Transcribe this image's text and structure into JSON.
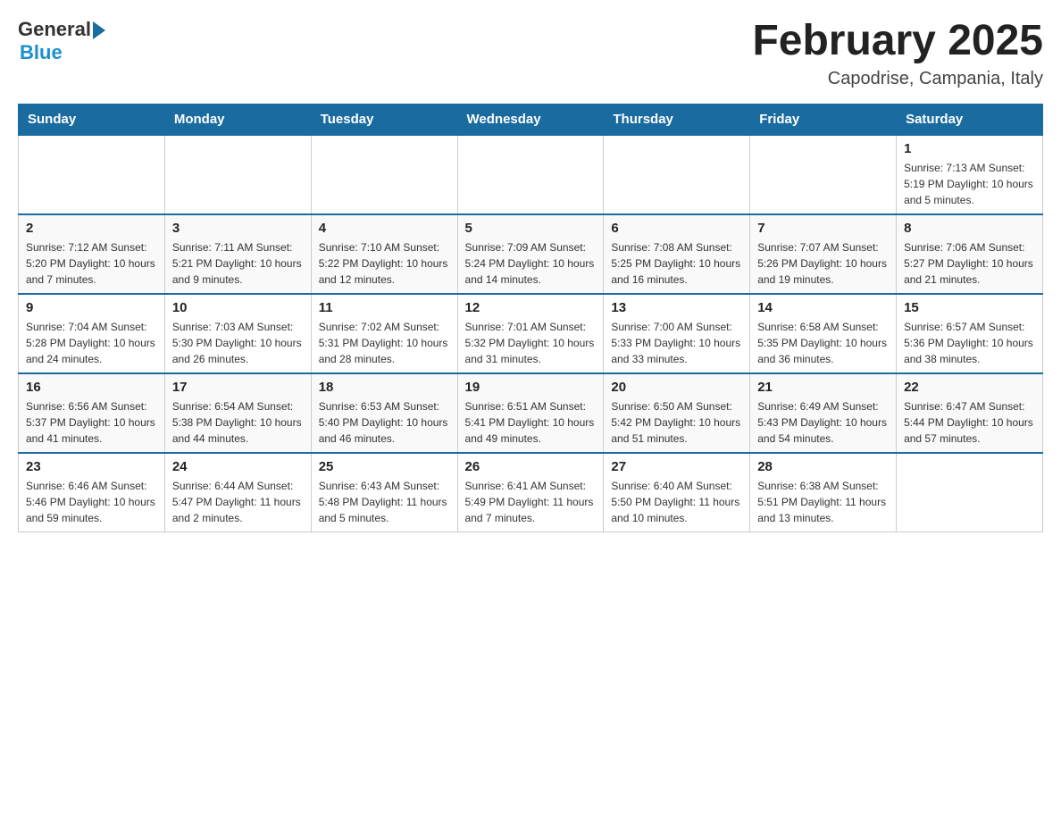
{
  "header": {
    "logo_general": "General",
    "logo_blue": "Blue",
    "title": "February 2025",
    "subtitle": "Capodrise, Campania, Italy"
  },
  "days_of_week": [
    "Sunday",
    "Monday",
    "Tuesday",
    "Wednesday",
    "Thursday",
    "Friday",
    "Saturday"
  ],
  "weeks": [
    [
      {
        "day": "",
        "info": ""
      },
      {
        "day": "",
        "info": ""
      },
      {
        "day": "",
        "info": ""
      },
      {
        "day": "",
        "info": ""
      },
      {
        "day": "",
        "info": ""
      },
      {
        "day": "",
        "info": ""
      },
      {
        "day": "1",
        "info": "Sunrise: 7:13 AM\nSunset: 5:19 PM\nDaylight: 10 hours and 5 minutes."
      }
    ],
    [
      {
        "day": "2",
        "info": "Sunrise: 7:12 AM\nSunset: 5:20 PM\nDaylight: 10 hours and 7 minutes."
      },
      {
        "day": "3",
        "info": "Sunrise: 7:11 AM\nSunset: 5:21 PM\nDaylight: 10 hours and 9 minutes."
      },
      {
        "day": "4",
        "info": "Sunrise: 7:10 AM\nSunset: 5:22 PM\nDaylight: 10 hours and 12 minutes."
      },
      {
        "day": "5",
        "info": "Sunrise: 7:09 AM\nSunset: 5:24 PM\nDaylight: 10 hours and 14 minutes."
      },
      {
        "day": "6",
        "info": "Sunrise: 7:08 AM\nSunset: 5:25 PM\nDaylight: 10 hours and 16 minutes."
      },
      {
        "day": "7",
        "info": "Sunrise: 7:07 AM\nSunset: 5:26 PM\nDaylight: 10 hours and 19 minutes."
      },
      {
        "day": "8",
        "info": "Sunrise: 7:06 AM\nSunset: 5:27 PM\nDaylight: 10 hours and 21 minutes."
      }
    ],
    [
      {
        "day": "9",
        "info": "Sunrise: 7:04 AM\nSunset: 5:28 PM\nDaylight: 10 hours and 24 minutes."
      },
      {
        "day": "10",
        "info": "Sunrise: 7:03 AM\nSunset: 5:30 PM\nDaylight: 10 hours and 26 minutes."
      },
      {
        "day": "11",
        "info": "Sunrise: 7:02 AM\nSunset: 5:31 PM\nDaylight: 10 hours and 28 minutes."
      },
      {
        "day": "12",
        "info": "Sunrise: 7:01 AM\nSunset: 5:32 PM\nDaylight: 10 hours and 31 minutes."
      },
      {
        "day": "13",
        "info": "Sunrise: 7:00 AM\nSunset: 5:33 PM\nDaylight: 10 hours and 33 minutes."
      },
      {
        "day": "14",
        "info": "Sunrise: 6:58 AM\nSunset: 5:35 PM\nDaylight: 10 hours and 36 minutes."
      },
      {
        "day": "15",
        "info": "Sunrise: 6:57 AM\nSunset: 5:36 PM\nDaylight: 10 hours and 38 minutes."
      }
    ],
    [
      {
        "day": "16",
        "info": "Sunrise: 6:56 AM\nSunset: 5:37 PM\nDaylight: 10 hours and 41 minutes."
      },
      {
        "day": "17",
        "info": "Sunrise: 6:54 AM\nSunset: 5:38 PM\nDaylight: 10 hours and 44 minutes."
      },
      {
        "day": "18",
        "info": "Sunrise: 6:53 AM\nSunset: 5:40 PM\nDaylight: 10 hours and 46 minutes."
      },
      {
        "day": "19",
        "info": "Sunrise: 6:51 AM\nSunset: 5:41 PM\nDaylight: 10 hours and 49 minutes."
      },
      {
        "day": "20",
        "info": "Sunrise: 6:50 AM\nSunset: 5:42 PM\nDaylight: 10 hours and 51 minutes."
      },
      {
        "day": "21",
        "info": "Sunrise: 6:49 AM\nSunset: 5:43 PM\nDaylight: 10 hours and 54 minutes."
      },
      {
        "day": "22",
        "info": "Sunrise: 6:47 AM\nSunset: 5:44 PM\nDaylight: 10 hours and 57 minutes."
      }
    ],
    [
      {
        "day": "23",
        "info": "Sunrise: 6:46 AM\nSunset: 5:46 PM\nDaylight: 10 hours and 59 minutes."
      },
      {
        "day": "24",
        "info": "Sunrise: 6:44 AM\nSunset: 5:47 PM\nDaylight: 11 hours and 2 minutes."
      },
      {
        "day": "25",
        "info": "Sunrise: 6:43 AM\nSunset: 5:48 PM\nDaylight: 11 hours and 5 minutes."
      },
      {
        "day": "26",
        "info": "Sunrise: 6:41 AM\nSunset: 5:49 PM\nDaylight: 11 hours and 7 minutes."
      },
      {
        "day": "27",
        "info": "Sunrise: 6:40 AM\nSunset: 5:50 PM\nDaylight: 11 hours and 10 minutes."
      },
      {
        "day": "28",
        "info": "Sunrise: 6:38 AM\nSunset: 5:51 PM\nDaylight: 11 hours and 13 minutes."
      },
      {
        "day": "",
        "info": ""
      }
    ]
  ]
}
